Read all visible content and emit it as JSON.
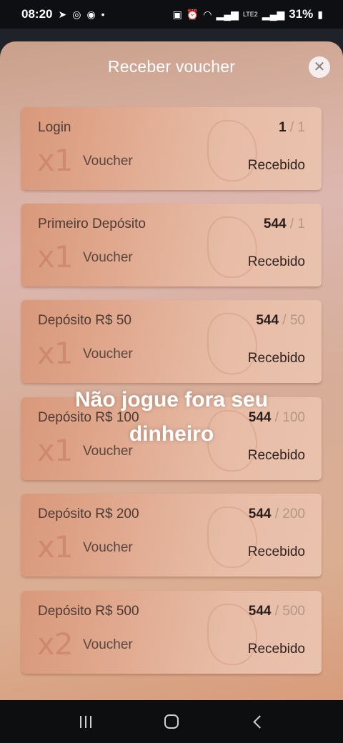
{
  "status_bar": {
    "time": "08:20",
    "battery": "31%",
    "network": "LTE2"
  },
  "modal": {
    "title": "Receber voucher",
    "close_icon": "close-icon"
  },
  "vouchers": [
    {
      "title": "Login",
      "current": "1",
      "target": "1",
      "multiplier": "x1",
      "type": "Voucher",
      "status": "Recebido"
    },
    {
      "title": "Primeiro Depósito",
      "current": "544",
      "target": "1",
      "multiplier": "x1",
      "type": "Voucher",
      "status": "Recebido"
    },
    {
      "title": "Depósito R$ 50",
      "current": "544",
      "target": "50",
      "multiplier": "x1",
      "type": "Voucher",
      "status": "Recebido"
    },
    {
      "title": "Depósito R$ 100",
      "current": "544",
      "target": "100",
      "multiplier": "x1",
      "type": "Voucher",
      "status": "Recebido"
    },
    {
      "title": "Depósito R$ 200",
      "current": "544",
      "target": "200",
      "multiplier": "x1",
      "type": "Voucher",
      "status": "Recebido"
    },
    {
      "title": "Depósito R$ 500",
      "current": "544",
      "target": "500",
      "multiplier": "x2",
      "type": "Voucher",
      "status": "Recebido"
    }
  ],
  "overlay_caption": {
    "line1": "Não jogue fora seu",
    "line2": "dinheiro"
  },
  "colors": {
    "card": "#e2ad94",
    "sheet": "#dcb7b0",
    "title": "#ffffff"
  }
}
